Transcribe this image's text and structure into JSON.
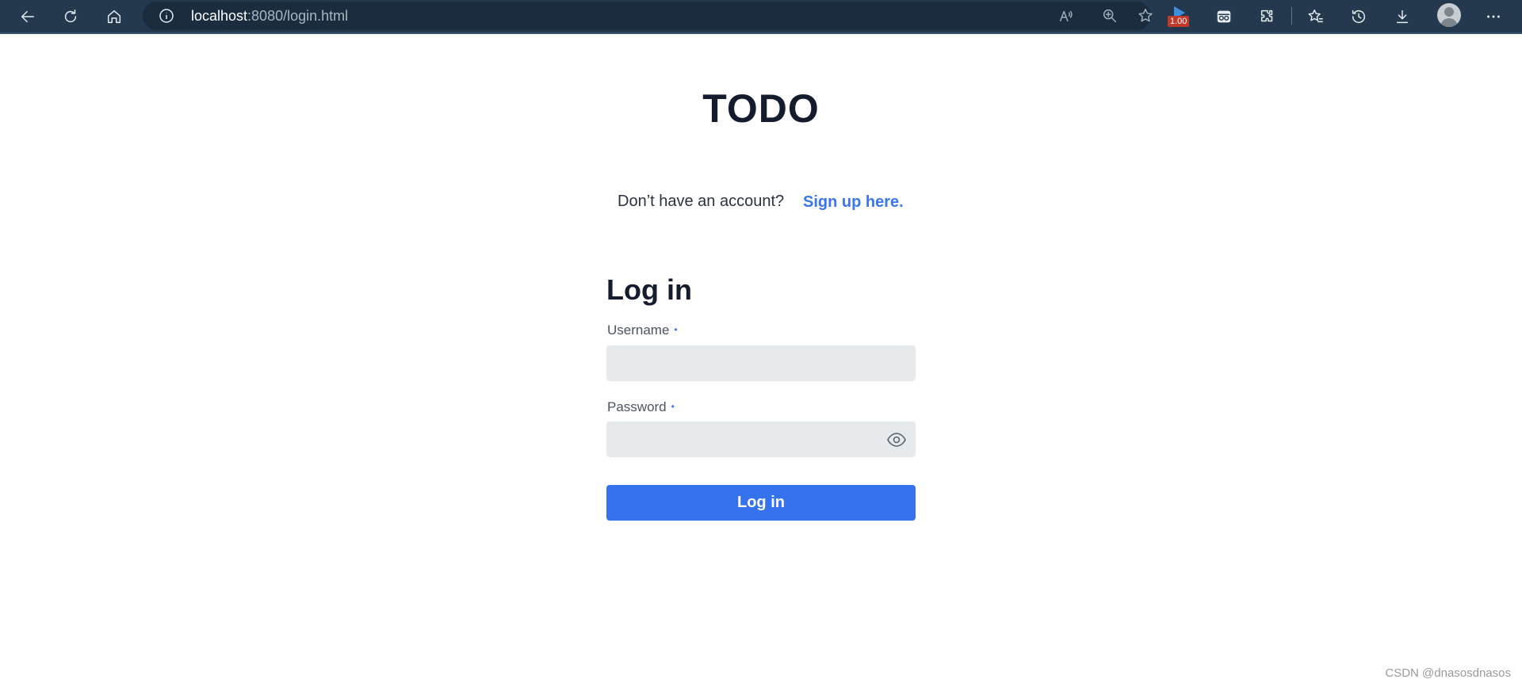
{
  "browser": {
    "url_host": "localhost",
    "url_rest": ":8080/login.html",
    "extension_badge": "1.00",
    "icons": {
      "back": "back-arrow-icon",
      "refresh": "refresh-icon",
      "home": "home-icon",
      "info": "info-icon",
      "read_aloud": "read-aloud-icon",
      "zoom": "zoom-icon",
      "favorite_add": "favorite-add-icon",
      "extension_play": "play-extension-icon",
      "extension_glasses": "glasses-extension-icon",
      "extensions": "puzzle-icon",
      "favorites": "favorites-icon",
      "history": "history-icon",
      "downloads": "download-icon",
      "profile": "profile-avatar",
      "menu": "more-icon"
    },
    "colors": {
      "toolbar": "#24394d",
      "address_bar": "#1a2c3d"
    }
  },
  "page": {
    "title": "TODO",
    "signup_prompt": "Don’t have an account?",
    "signup_link": "Sign up here."
  },
  "login_form": {
    "heading": "Log in",
    "username_label": "Username",
    "username_required_marker": "•",
    "username_value": "",
    "password_label": "Password",
    "password_required_marker": "•",
    "password_value": "",
    "submit_label": "Log in"
  },
  "colors": {
    "accent": "#3672ee",
    "input_bg": "#e7eaed",
    "heading": "#141c2e"
  },
  "watermark": "CSDN @dnasosdnasos"
}
